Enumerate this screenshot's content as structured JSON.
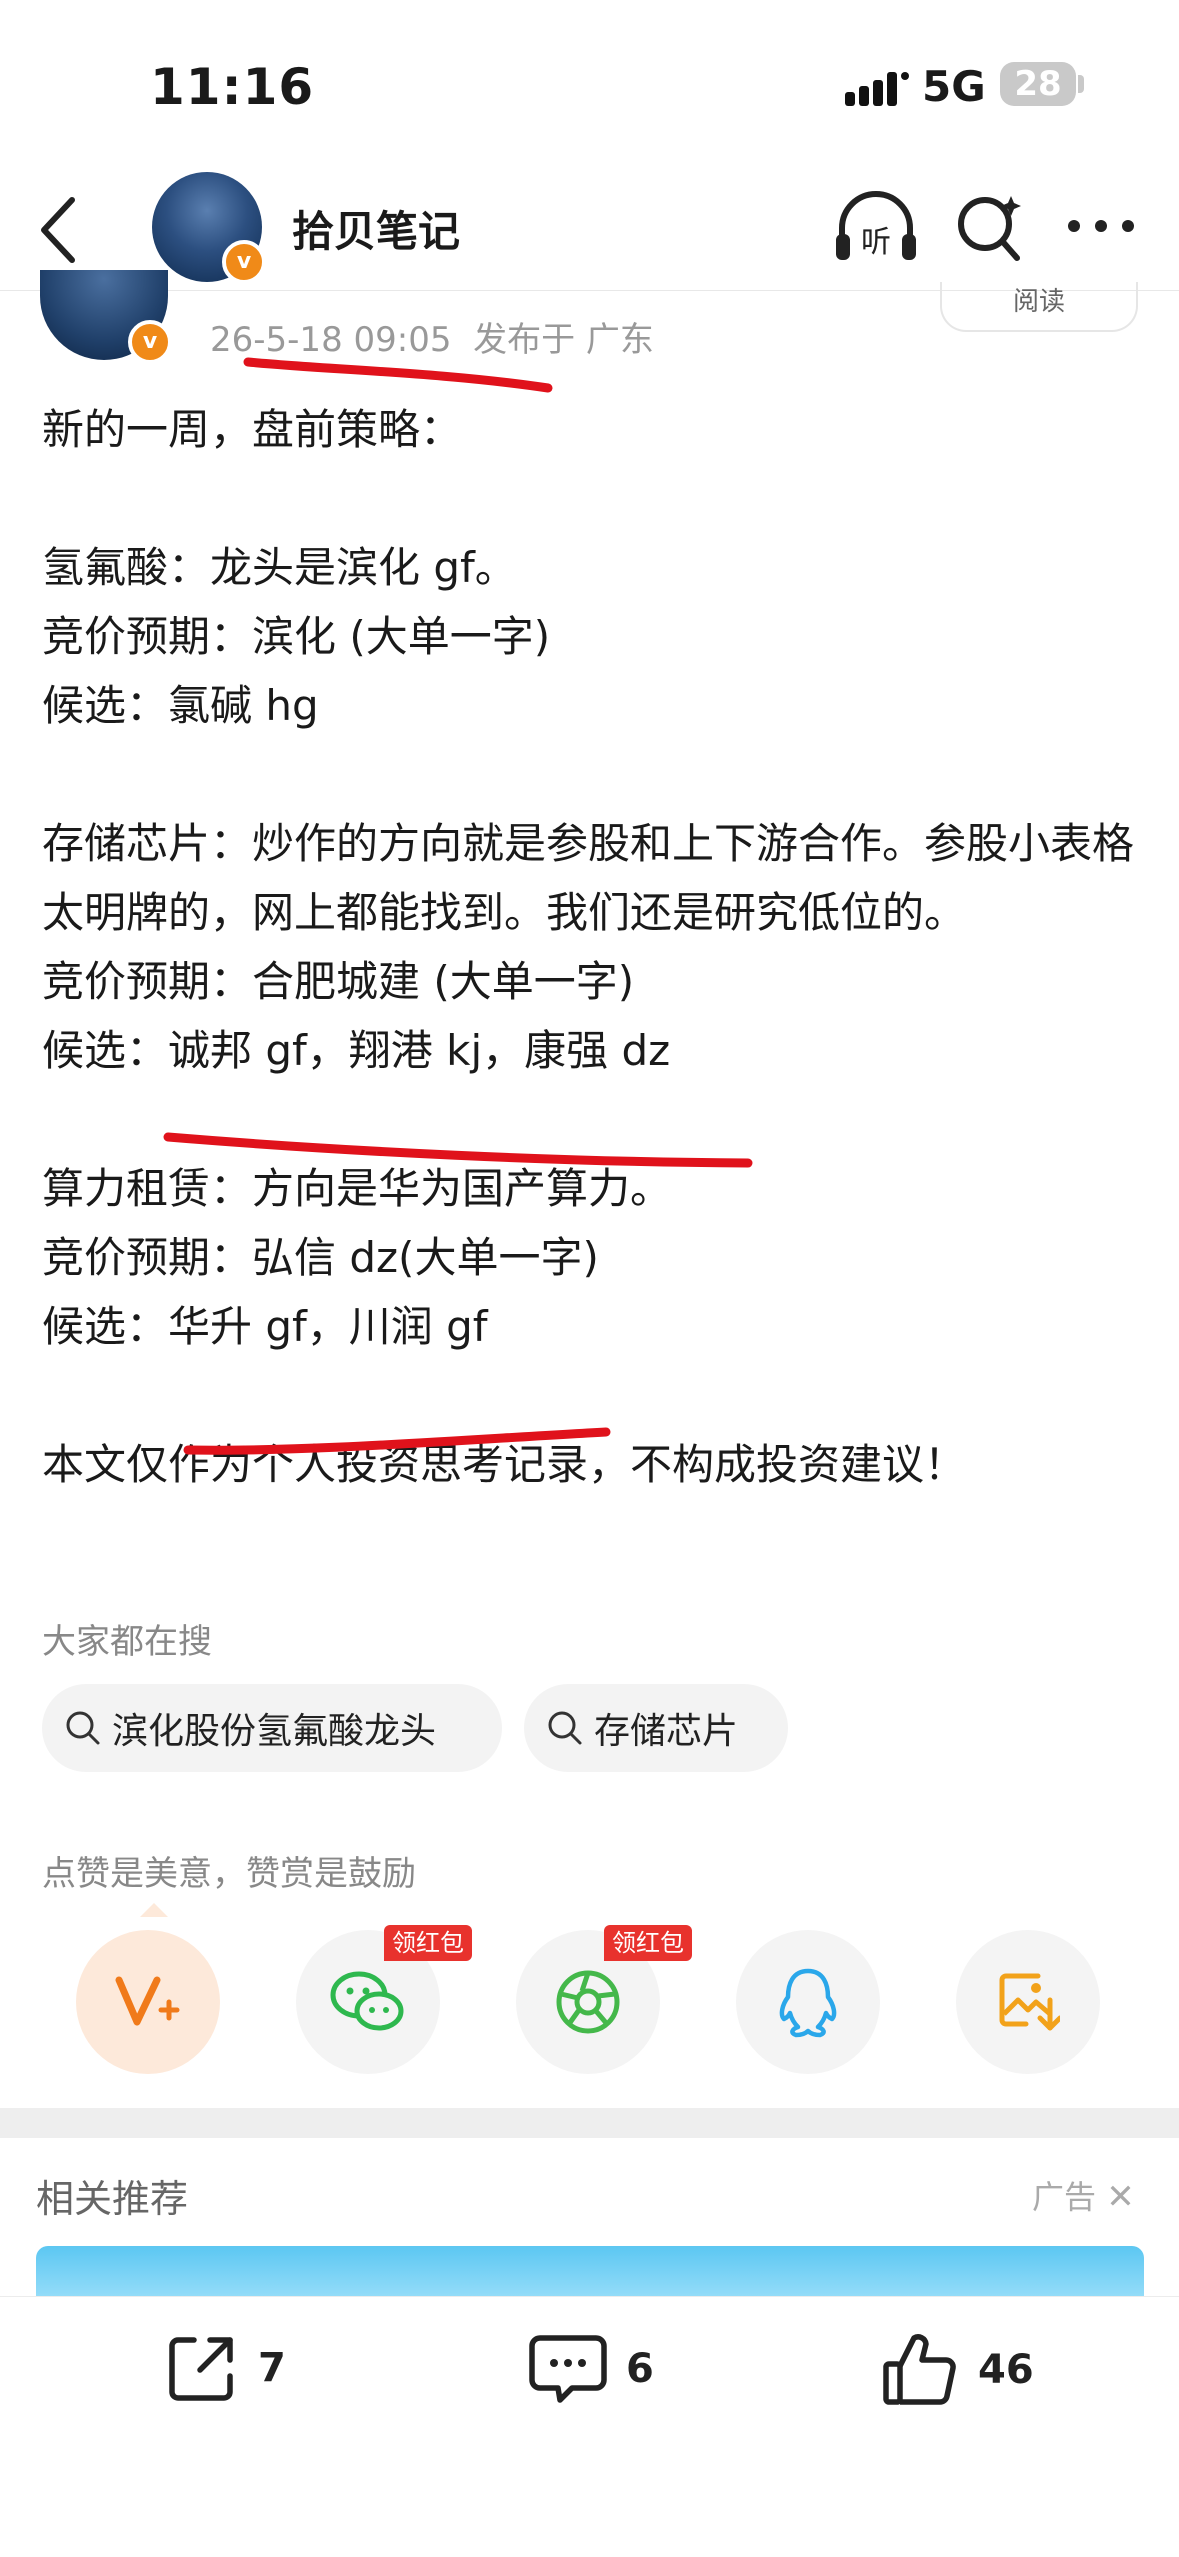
{
  "status_bar": {
    "time": "11:16",
    "network": "5G",
    "battery": "28"
  },
  "nav": {
    "author": "拾贝笔记",
    "verified_badge": "v",
    "listen_icon_text": "听"
  },
  "meta": {
    "date": "26-5-18 09:05",
    "location": "发布于 广东",
    "read_label": "阅读"
  },
  "article": {
    "title_line": "新的一周，盘前策略：",
    "p1": [
      "氢氟酸：龙头是滨化 gf。",
      "竞价预期：滨化 (大单一字)",
      "候选：氯碱 hg"
    ],
    "p2": [
      "存储芯片：炒作的方向就是参股和上下游合作。参股小表格太明牌的，网上都能找到。我们还是研究低位的。",
      "竞价预期：合肥城建 (大单一字)",
      "候选：诚邦 gf，翔港 kj，康强 dz"
    ],
    "p3": [
      "算力租赁：方向是华为国产算力。",
      "竞价预期：弘信 dz(大单一字)",
      "候选：华升 gf，川润 gf"
    ],
    "disclaimer": "本文仅作为个人投资思考记录，不构成投资建议！"
  },
  "search_section": {
    "heading": "大家都在搜",
    "chips": [
      "滨化股份氢氟酸龙头",
      "存储芯片"
    ]
  },
  "reward": {
    "heading": "点赞是美意，赞赏是鼓励",
    "tag": "领红包"
  },
  "share_icons": [
    "v-plus-icon",
    "wechat-icon",
    "moments-icon",
    "qq-icon",
    "save-image-icon"
  ],
  "related": {
    "heading": "相关推荐",
    "ad_label": "广告"
  },
  "bottom_bar": {
    "share_count": "7",
    "comment_count": "6",
    "like_count": "46"
  },
  "colors": {
    "accent_orange": "#f08a18",
    "red_tag": "#e8322d",
    "pen_red": "#e0121b"
  }
}
